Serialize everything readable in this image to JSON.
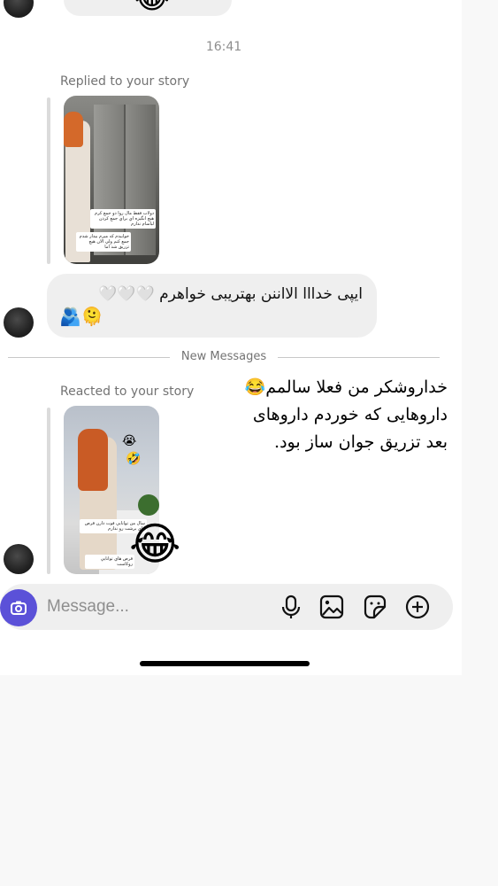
{
  "timestamp": "16:41",
  "replied_story": {
    "label": "Replied to your story",
    "caption_1": "دولاب فقط مال روا دو جمع كرم هيچ انگيزه اي براي جمع كردن لباسام ندارم",
    "caption_2": "خوابيدم كه ميرم بيدار شدم جمع كنم ولي الان هيچ تزريق شد اما"
  },
  "message": {
    "text": "ایپی خدااا الااننن بهتریبی خواهرم 🤍🤍🤍",
    "emojis": "🫂🫠"
  },
  "divider": {
    "label": "New Messages"
  },
  "reacted_story": {
    "label": "Reacted to your story",
    "caption_1": "سال من توانايي فوت دارن قرص هاي برشت رو ندارم",
    "caption_2": "قرص هاي توانایي روکاست",
    "story_emoji_1": "😭",
    "story_emoji_2": "🤣",
    "reaction": "😂"
  },
  "overlay_note": {
    "lines": [
      "خداروشکر من فعلا سالمم😂",
      "داروهایی که خوردم داروهای",
      "بعد تزریق جوان ساز بود."
    ]
  },
  "top_reaction_emoji": "😂",
  "composer": {
    "placeholder": "Message...",
    "icons": [
      "camera-icon",
      "microphone-icon",
      "gallery-icon",
      "sticker-icon",
      "plus-icon"
    ]
  },
  "colors": {
    "accent": "#5b51d8",
    "bubble": "#efefef",
    "secondary_text": "#737373"
  }
}
